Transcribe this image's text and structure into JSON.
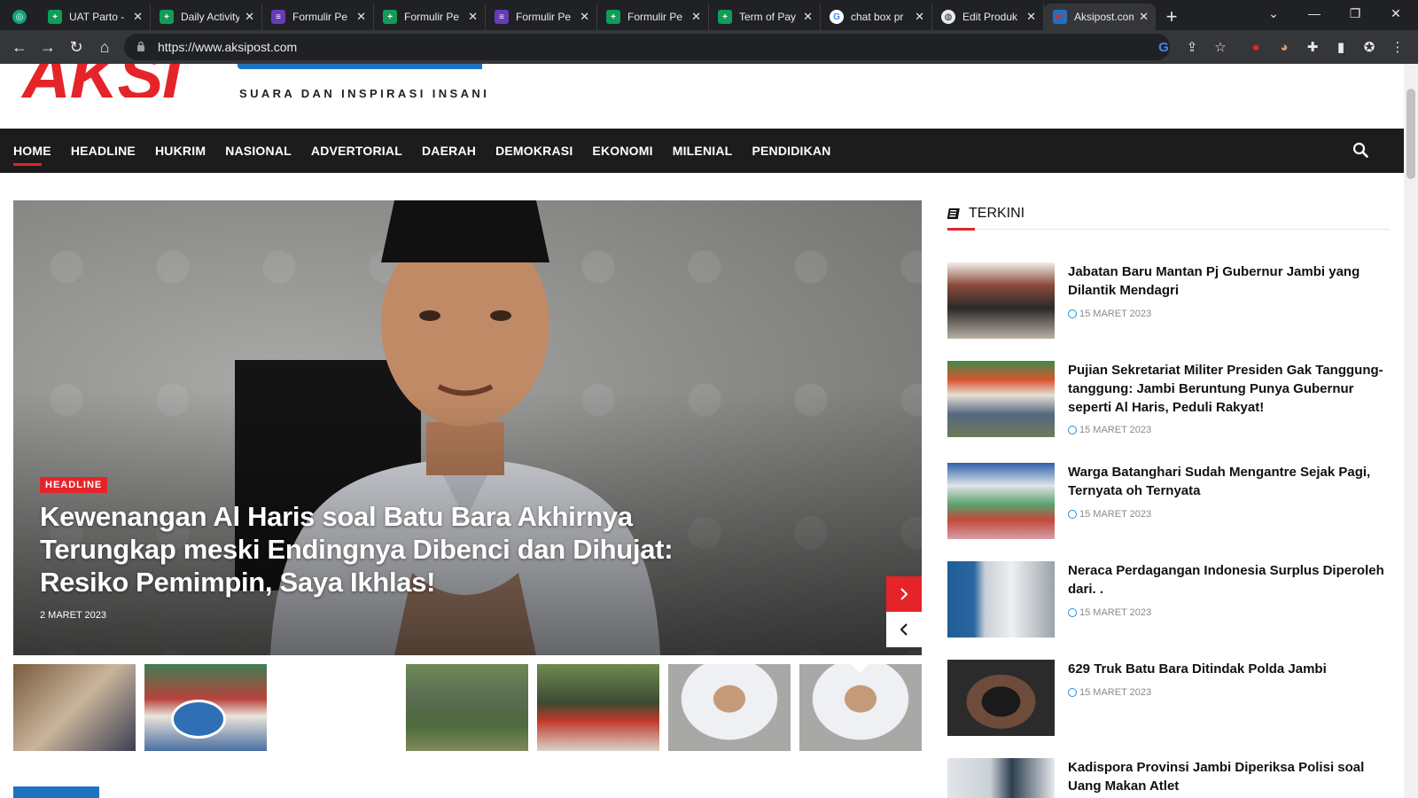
{
  "browser": {
    "tabs": [
      {
        "label": "",
        "icon": "chatgpt-icon",
        "color": "#10a37f"
      },
      {
        "label": "UAT Parto -",
        "icon": "sheets-icon",
        "color": "#0f9d58"
      },
      {
        "label": "Daily Activity",
        "icon": "sheets-icon",
        "color": "#0f9d58"
      },
      {
        "label": "Formulir Pe",
        "icon": "forms-icon",
        "color": "#673ab7"
      },
      {
        "label": "Formulir Pe",
        "icon": "sheets-icon",
        "color": "#0f9d58"
      },
      {
        "label": "Formulir Pe",
        "icon": "forms-icon",
        "color": "#673ab7"
      },
      {
        "label": "Formulir Pe",
        "icon": "sheets-icon",
        "color": "#0f9d58"
      },
      {
        "label": "Term of Pay",
        "icon": "sheets-icon",
        "color": "#0f9d58"
      },
      {
        "label": "chat box pr",
        "icon": "google-icon",
        "color": "#ffffff"
      },
      {
        "label": "Edit Produk",
        "icon": "globe-icon",
        "color": "#e8eaed"
      },
      {
        "label": "Aksipost.com",
        "icon": "aksipost-icon",
        "color": "#1e73be",
        "active": true
      }
    ],
    "url": "https://www.aksipost.com"
  },
  "site": {
    "tagline": "SUARA DAN INSPIRASI INSANI",
    "brand_red": "#e5242a",
    "brand_blue": "#1e73be"
  },
  "nav": {
    "items": [
      "HOME",
      "HEADLINE",
      "HUKRIM",
      "NASIONAL",
      "ADVERTORIAL",
      "DAERAH",
      "DEMOKRASI",
      "EKONOMI",
      "MILENIAL",
      "PENDIDIKAN"
    ]
  },
  "hero": {
    "category": "HEADLINE",
    "title": "Kewenangan Al Haris soal Batu Bara Akhirnya Terungkap meski Endingnya Dibenci dan Dihujat: Resiko Pemimpin, Saya Ikhlas!",
    "date": "2 MARET 2023"
  },
  "sidebar": {
    "heading": "TERKINI",
    "posts": [
      {
        "title": "Jabatan Baru Mantan Pj Gubernur Jambi yang Dilantik Mendagri",
        "date": "15 MARET 2023"
      },
      {
        "title": "Pujian Sekretariat Militer Presiden Gak Tanggung-tanggung: Jambi Beruntung Punya Gubernur seperti Al Haris, Peduli Rakyat!",
        "date": "15 MARET 2023"
      },
      {
        "title": "Warga Batanghari Sudah Mengantre Sejak Pagi, Ternyata oh Ternyata",
        "date": "15 MARET 2023"
      },
      {
        "title": "Neraca Perdagangan Indonesia Surplus Diperoleh dari. .",
        "date": "15 MARET 2023"
      },
      {
        "title": "629 Truk Batu Bara Ditindak Polda Jambi",
        "date": "15 MARET 2023"
      },
      {
        "title": "Kadispora Provinsi Jambi Diperiksa Polisi soal Uang Makan Atlet",
        "date": ""
      }
    ]
  }
}
